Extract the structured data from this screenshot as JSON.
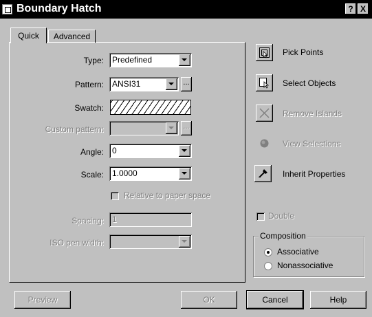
{
  "window": {
    "title": "Boundary Hatch",
    "help_label": "?",
    "close_label": "X"
  },
  "tabs": [
    {
      "label": "Quick",
      "active": true
    },
    {
      "label": "Advanced",
      "active": false
    }
  ],
  "fields": {
    "type": {
      "label": "Type:",
      "value": "Predefined"
    },
    "pattern": {
      "label": "Pattern:",
      "value": "ANSI31",
      "ellipsis": "..."
    },
    "swatch": {
      "label": "Swatch:"
    },
    "custom_pattern": {
      "label": "Custom pattern:",
      "value": "",
      "ellipsis": "..."
    },
    "angle": {
      "label": "Angle:",
      "value": "0"
    },
    "scale": {
      "label": "Scale:",
      "value": "1.0000"
    },
    "relative": {
      "label": "Relative to paper space",
      "checked": false
    },
    "spacing": {
      "label": "Spacing:",
      "value": "1"
    },
    "iso_pen_width": {
      "label": "ISO pen width:",
      "value": ""
    }
  },
  "actions": [
    {
      "label": "Pick Points",
      "icon": "pick-points-icon",
      "enabled": true
    },
    {
      "label": "Select Objects",
      "icon": "select-objects-icon",
      "enabled": true
    },
    {
      "label": "Remove Islands",
      "icon": "remove-islands-icon",
      "enabled": false
    },
    {
      "label": "View Selections",
      "icon": "view-selections-icon",
      "enabled": false
    },
    {
      "label": "Inherit Properties",
      "icon": "inherit-properties-icon",
      "enabled": true
    }
  ],
  "double": {
    "label": "Double",
    "checked": false
  },
  "composition": {
    "title": "Composition",
    "options": [
      {
        "label": "Associative",
        "selected": true
      },
      {
        "label": "Nonassociative",
        "selected": false
      }
    ]
  },
  "buttons": {
    "preview": "Preview",
    "ok": "OK",
    "cancel": "Cancel",
    "help": "Help"
  }
}
